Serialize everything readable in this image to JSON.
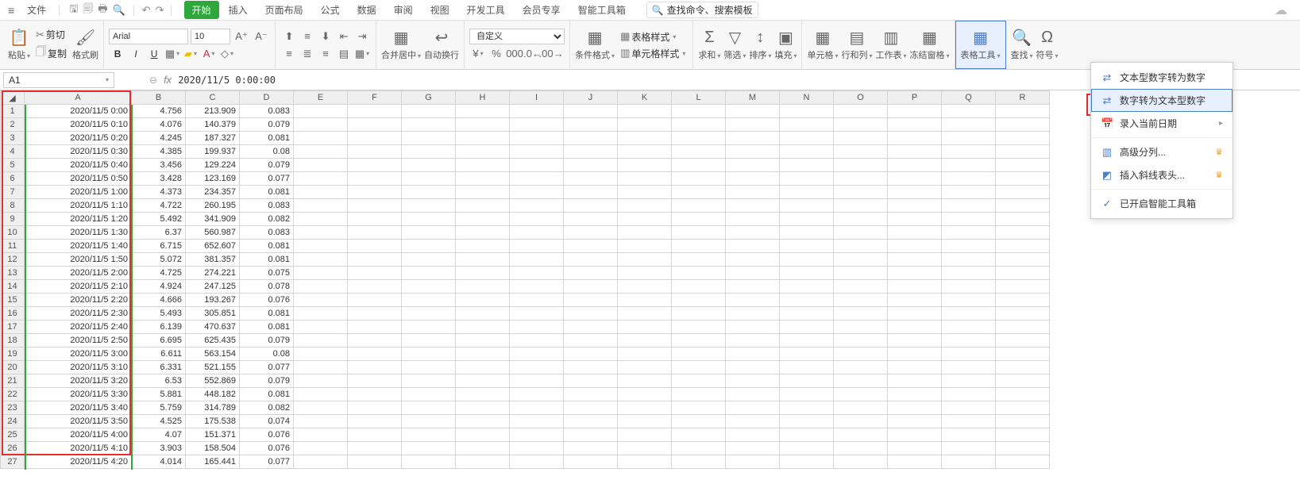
{
  "menu": {
    "file": "文件"
  },
  "tabs": [
    "开始",
    "插入",
    "页面布局",
    "公式",
    "数据",
    "审阅",
    "视图",
    "开发工具",
    "会员专享",
    "智能工具箱"
  ],
  "search_placeholder": "查找命令、搜索模板",
  "ribbon": {
    "paste": "粘贴",
    "cut": "剪切",
    "copy": "复制",
    "fmtpaint": "格式刷",
    "font": "Arial",
    "size": "10",
    "merge": "合并居中",
    "wrap": "自动换行",
    "numfmt": "自定义",
    "cond": "条件格式",
    "tblstyle": "表格样式",
    "cellstyle": "单元格样式",
    "sum": "求和",
    "filter": "筛选",
    "sort": "排序",
    "fill": "填充",
    "cells": "单元格",
    "rowcol": "行和列",
    "ws": "工作表",
    "freeze": "冻结窗格",
    "tbltool": "表格工具",
    "find": "查找",
    "symbol": "符号"
  },
  "namebox": "A1",
  "formula": "2020/11/5 0:00:00",
  "cols": [
    "A",
    "B",
    "C",
    "D",
    "E",
    "F",
    "G",
    "H",
    "I",
    "J",
    "K",
    "L",
    "M",
    "N",
    "O",
    "P",
    "Q",
    "R"
  ],
  "rows": [
    {
      "a": "2020/11/5 0:00",
      "b": "4.756",
      "c": "213.909",
      "d": "0.083"
    },
    {
      "a": "2020/11/5 0:10",
      "b": "4.076",
      "c": "140.379",
      "d": "0.079"
    },
    {
      "a": "2020/11/5 0:20",
      "b": "4.245",
      "c": "187.327",
      "d": "0.081"
    },
    {
      "a": "2020/11/5 0:30",
      "b": "4.385",
      "c": "199.937",
      "d": "0.08"
    },
    {
      "a": "2020/11/5 0:40",
      "b": "3.456",
      "c": "129.224",
      "d": "0.079"
    },
    {
      "a": "2020/11/5 0:50",
      "b": "3.428",
      "c": "123.169",
      "d": "0.077"
    },
    {
      "a": "2020/11/5 1:00",
      "b": "4.373",
      "c": "234.357",
      "d": "0.081"
    },
    {
      "a": "2020/11/5 1:10",
      "b": "4.722",
      "c": "260.195",
      "d": "0.083"
    },
    {
      "a": "2020/11/5 1:20",
      "b": "5.492",
      "c": "341.909",
      "d": "0.082"
    },
    {
      "a": "2020/11/5 1:30",
      "b": "6.37",
      "c": "560.987",
      "d": "0.083"
    },
    {
      "a": "2020/11/5 1:40",
      "b": "6.715",
      "c": "652.607",
      "d": "0.081"
    },
    {
      "a": "2020/11/5 1:50",
      "b": "5.072",
      "c": "381.357",
      "d": "0.081"
    },
    {
      "a": "2020/11/5 2:00",
      "b": "4.725",
      "c": "274.221",
      "d": "0.075"
    },
    {
      "a": "2020/11/5 2:10",
      "b": "4.924",
      "c": "247.125",
      "d": "0.078"
    },
    {
      "a": "2020/11/5 2:20",
      "b": "4.666",
      "c": "193.267",
      "d": "0.076"
    },
    {
      "a": "2020/11/5 2:30",
      "b": "5.493",
      "c": "305.851",
      "d": "0.081"
    },
    {
      "a": "2020/11/5 2:40",
      "b": "6.139",
      "c": "470.637",
      "d": "0.081"
    },
    {
      "a": "2020/11/5 2:50",
      "b": "6.695",
      "c": "625.435",
      "d": "0.079"
    },
    {
      "a": "2020/11/5 3:00",
      "b": "6.611",
      "c": "563.154",
      "d": "0.08"
    },
    {
      "a": "2020/11/5 3:10",
      "b": "6.331",
      "c": "521.155",
      "d": "0.077"
    },
    {
      "a": "2020/11/5 3:20",
      "b": "6.53",
      "c": "552.869",
      "d": "0.079"
    },
    {
      "a": "2020/11/5 3:30",
      "b": "5.881",
      "c": "448.182",
      "d": "0.081"
    },
    {
      "a": "2020/11/5 3:40",
      "b": "5.759",
      "c": "314.789",
      "d": "0.082"
    },
    {
      "a": "2020/11/5 3:50",
      "b": "4.525",
      "c": "175.538",
      "d": "0.074"
    },
    {
      "a": "2020/11/5 4:00",
      "b": "4.07",
      "c": "151.371",
      "d": "0.076"
    },
    {
      "a": "2020/11/5 4:10",
      "b": "3.903",
      "c": "158.504",
      "d": "0.076"
    },
    {
      "a": "2020/11/5 4:20",
      "b": "4.014",
      "c": "165.441",
      "d": "0.077"
    }
  ],
  "menuitems": {
    "m1": "文本型数字转为数字",
    "m2": "数字转为文本型数字",
    "m3": "录入当前日期",
    "m4": "高级分列...",
    "m5": "插入斜线表头...",
    "m6": "已开启智能工具箱"
  }
}
